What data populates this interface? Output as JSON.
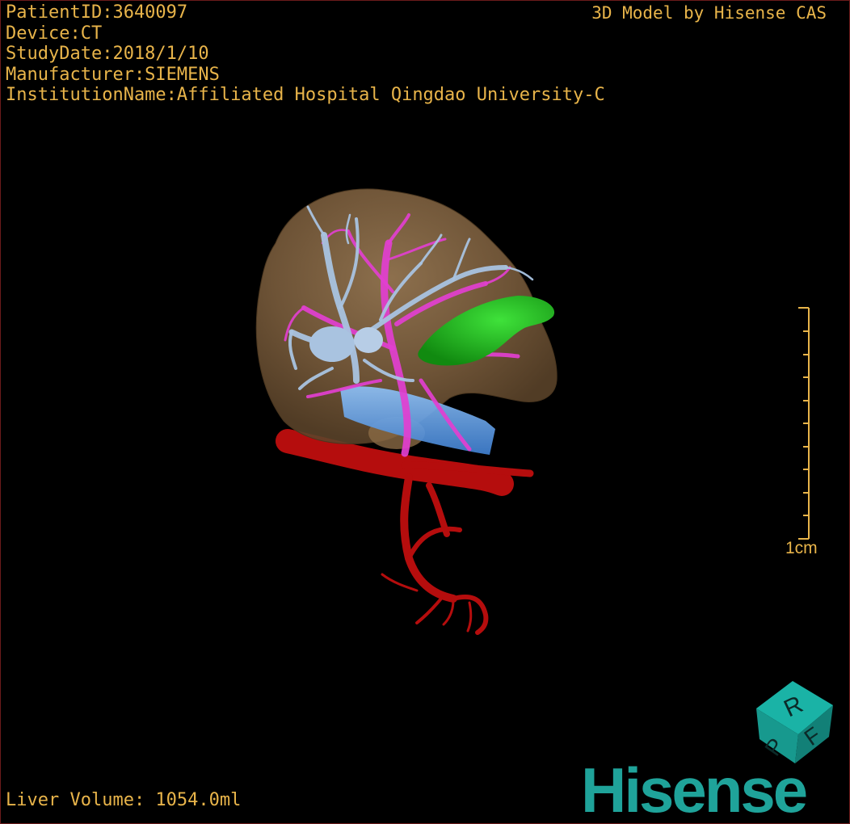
{
  "study_info": {
    "patient_id": "PatientID:3640097",
    "device": "Device:CT",
    "study_date": "StudyDate:2018/1/10",
    "manufacturer": "Manufacturer:SIEMENS",
    "institution": "InstitutionName:Affiliated Hospital Qingdao University-C"
  },
  "credit": "3D Model by Hisense CAS",
  "liver_volume": "Liver Volume: 1054.0ml",
  "scale_bar": {
    "label": "1cm"
  },
  "orientation_cube": {
    "face_top": "R",
    "face_left": "P",
    "face_right": "F"
  },
  "brand": {
    "name": "Hisense"
  },
  "colors": {
    "text": "#e8b44a",
    "liver": "#8a6a45",
    "hepatic_vein": "#a9c3e0",
    "portal_vein": "#e23fd0",
    "gallbladder": "#22b81f",
    "vena_cava": "#5fa0e8",
    "artery": "#b50d0d",
    "brand": "#1fa39a"
  },
  "icons": {
    "orientation_cube": "orientation-cube-icon",
    "scale_bar": "scale-bar-icon"
  }
}
